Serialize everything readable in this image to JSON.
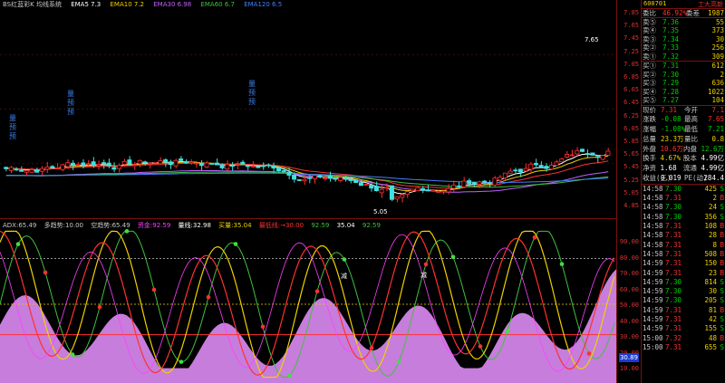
{
  "main_chart": {
    "legend": [
      {
        "label": "BS红蓝彩K 均线系统",
        "color": "#c8c8c8"
      },
      {
        "label": "EMA5 7.3",
        "color": "#ffffff"
      },
      {
        "label": "EMA10 7.2",
        "color": "#f0d000"
      },
      {
        "label": "EMA30 6.98",
        "color": "#c060ff"
      },
      {
        "label": "EMA60 6.7",
        "color": "#40c040"
      },
      {
        "label": "EMA120 6.5",
        "color": "#4080ff"
      }
    ],
    "signals": [
      {
        "chars": [
          "量",
          "预",
          "预"
        ]
      },
      {
        "chars": [
          "量",
          "预",
          "预"
        ]
      },
      {
        "chars": [
          "量",
          "预",
          "预"
        ]
      }
    ],
    "low_label": "5.05",
    "high_label": "7.65"
  },
  "price_axis": [
    "7.85",
    "7.65",
    "7.45",
    "7.25",
    "7.05",
    "6.85",
    "6.65",
    "6.45",
    "6.25",
    "6.05",
    "5.85",
    "5.65",
    "5.45",
    "5.25",
    "5.05",
    "4.85"
  ],
  "indicator": {
    "legend": [
      {
        "label": "ADX:65.49",
        "color": "#c8c8c8"
      },
      {
        "label": "多趋势:10.00",
        "color": "#c8c8c8"
      },
      {
        "label": "空趋势:65.49",
        "color": "#c8c8c8"
      },
      {
        "label": "资金:92.59",
        "color": "#ff40ff"
      },
      {
        "label": "量线:32.98",
        "color": "#ffffff"
      },
      {
        "label": "买量:35.04",
        "color": "#f0d000"
      },
      {
        "label": "最低线:→30.00",
        "color": "#ff3030"
      },
      {
        "label": "92.59",
        "color": "#40c040"
      },
      {
        "label": "35.04",
        "color": "#ffffff"
      },
      {
        "label": "92.59",
        "color": "#40c040"
      }
    ],
    "markers": [
      "减",
      "减"
    ],
    "current_value": "30.89"
  },
  "indicator_axis": [
    "90.00",
    "80.00",
    "70.00",
    "60.00",
    "50.00",
    "40.00",
    "30.00",
    "20.00",
    "10.00"
  ],
  "quote": {
    "code": "600701",
    "name": "工大高新",
    "weibi_label": "委比",
    "weibi": "46.92%",
    "weicha_label": "委差",
    "weicha": "1987",
    "asks": [
      {
        "label": "卖⑤",
        "price": "7.36",
        "vol": "55"
      },
      {
        "label": "卖④",
        "price": "7.35",
        "vol": "373"
      },
      {
        "label": "卖③",
        "price": "7.34",
        "vol": "30"
      },
      {
        "label": "卖②",
        "price": "7.33",
        "vol": "256"
      },
      {
        "label": "卖①",
        "price": "7.32",
        "vol": "309"
      }
    ],
    "bids": [
      {
        "label": "买①",
        "price": "7.31",
        "vol": "612"
      },
      {
        "label": "买②",
        "price": "7.30",
        "vol": "2"
      },
      {
        "label": "买③",
        "price": "7.29",
        "vol": "636"
      },
      {
        "label": "买④",
        "price": "7.28",
        "vol": "1022"
      },
      {
        "label": "买⑤",
        "price": "7.27",
        "vol": "104"
      }
    ],
    "stats": [
      {
        "k1": "现价",
        "v1": "7.31",
        "c1": "red",
        "k2": "今开",
        "v2": "7.1",
        "c2": "red"
      },
      {
        "k1": "涨跌",
        "v1": "-0.08",
        "c1": "green",
        "k2": "最高",
        "v2": "7.65",
        "c2": "red"
      },
      {
        "k1": "涨幅",
        "v1": "-1.08%",
        "c1": "green",
        "k2": "最低",
        "v2": "7.21",
        "c2": "green"
      },
      {
        "k1": "总量",
        "v1": "23.3万",
        "c1": "yellow",
        "k2": "量比",
        "v2": "0.8",
        "c2": "yellow"
      },
      {
        "k1": "外盘",
        "v1": "10.6万",
        "c1": "red",
        "k2": "内盘",
        "v2": "12.6万",
        "c2": "green"
      },
      {
        "k1": "换手",
        "v1": "4.67%",
        "c1": "yellow",
        "k2": "股本",
        "v2": "4.99亿",
        "c2": "white"
      },
      {
        "k1": "净资",
        "v1": "1.68",
        "c1": "white",
        "k2": "流通",
        "v2": "4.99亿",
        "c2": "white"
      },
      {
        "k1": "收益(三)",
        "v1": "0.019",
        "c1": "white",
        "k2": "PE(动)",
        "v2": "284.4",
        "c2": "white"
      }
    ],
    "ticks": [
      {
        "time": "14:58",
        "price": "7.30",
        "vol": "425",
        "dir": "S"
      },
      {
        "time": "14:58",
        "price": "7.31",
        "vol": "2",
        "dir": "B"
      },
      {
        "time": "14:58",
        "price": "7.30",
        "vol": "24",
        "dir": "S"
      },
      {
        "time": "14:58",
        "price": "7.30",
        "vol": "356",
        "dir": "S"
      },
      {
        "time": "14:58",
        "price": "7.31",
        "vol": "108",
        "dir": "B"
      },
      {
        "time": "14:58",
        "price": "7.31",
        "vol": "28",
        "dir": "B"
      },
      {
        "time": "14:58",
        "price": "7.31",
        "vol": "8",
        "dir": "B"
      },
      {
        "time": "14:58",
        "price": "7.31",
        "vol": "508",
        "dir": "B"
      },
      {
        "time": "14:59",
        "price": "7.31",
        "vol": "150",
        "dir": "B"
      },
      {
        "time": "14:59",
        "price": "7.31",
        "vol": "23",
        "dir": "B"
      },
      {
        "time": "14:59",
        "price": "7.30",
        "vol": "814",
        "dir": "S"
      },
      {
        "time": "14:59",
        "price": "7.30",
        "vol": "30",
        "dir": "S"
      },
      {
        "time": "14:59",
        "price": "7.30",
        "vol": "205",
        "dir": "S"
      },
      {
        "time": "14:59",
        "price": "7.31",
        "vol": "81",
        "dir": "B"
      },
      {
        "time": "14:59",
        "price": "7.31",
        "vol": "42",
        "dir": "S"
      },
      {
        "time": "14:59",
        "price": "7.31",
        "vol": "155",
        "dir": "S"
      },
      {
        "time": "15:00",
        "price": "7.32",
        "vol": "48",
        "dir": "B"
      },
      {
        "time": "15:00",
        "price": "7.31",
        "vol": "655",
        "dir": "S"
      }
    ]
  }
}
